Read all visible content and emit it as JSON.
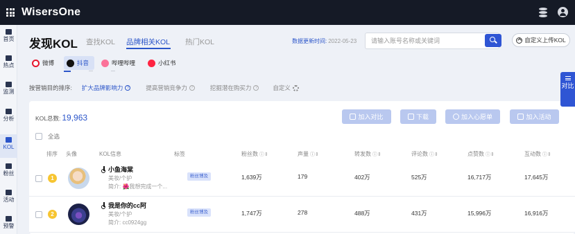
{
  "app": {
    "brand": "WisersOne"
  },
  "sidebar": {
    "items": [
      {
        "label": "首页",
        "icon": "home-icon"
      },
      {
        "label": "热点",
        "icon": "fire-icon"
      },
      {
        "label": "监测",
        "icon": "monitor-icon"
      },
      {
        "label": "分析",
        "icon": "analysis-icon"
      },
      {
        "label": "KOL",
        "icon": "kol-icon",
        "active": true
      },
      {
        "label": "粉丝",
        "icon": "fans-icon"
      },
      {
        "label": "活动",
        "icon": "activity-icon"
      },
      {
        "label": "预警",
        "icon": "alert-icon"
      }
    ]
  },
  "header": {
    "title": "发现KOL",
    "tabs": [
      {
        "label": "查找KOL",
        "active": false
      },
      {
        "label": "品牌相关KOL",
        "active": true
      },
      {
        "label": "热门KOL",
        "active": false
      }
    ],
    "update_label": "数据更新时间:",
    "update_value": "2022-05-23",
    "search_placeholder": "请输入账号名称或关键词",
    "upload_label": "自定义上传KOL"
  },
  "platforms": [
    {
      "label": "微博",
      "color": "#e6162d",
      "active": false
    },
    {
      "label": "抖音",
      "color": "#111111",
      "active": true
    },
    {
      "label": "哔哩哔哩",
      "color": "#fb7299",
      "active": false
    },
    {
      "label": "小红书",
      "color": "#ff2442",
      "active": false
    }
  ],
  "sort": {
    "label": "按营销目的排序:",
    "options": [
      {
        "label": "扩大品牌影响力",
        "active": true
      },
      {
        "label": "提高营销竞争力",
        "active": false
      },
      {
        "label": "挖掘潜在购买力",
        "active": false
      }
    ],
    "custom_label": "自定义"
  },
  "panel": {
    "total_label": "KOL总数:",
    "total_value": "19,963",
    "actions": [
      {
        "label": "加入对比",
        "icon": "compare-icon"
      },
      {
        "label": "下载",
        "icon": "download-icon"
      },
      {
        "label": "加入心愿单",
        "icon": "heart-icon"
      },
      {
        "label": "加入活动",
        "icon": "activity-icon"
      }
    ],
    "select_all": "全选"
  },
  "table": {
    "columns": {
      "rank": "排序",
      "avatar": "头像",
      "info": "KOL信息",
      "tags": "标签",
      "fans": "粉丝数",
      "voice": "声量",
      "reposts": "转发数",
      "comments": "评论数",
      "likes": "点赞数",
      "interactions": "互动数"
    },
    "rows": [
      {
        "rank": "1",
        "name": "小鱼海棠",
        "category": "美妆/个护",
        "bio": "简介: 🌺我想完成一个...",
        "tag": "粉丝博及",
        "fans": "1,639万",
        "voice": "179",
        "reposts": "402万",
        "comments": "525万",
        "likes": "16,717万",
        "interactions": "17,645万"
      },
      {
        "rank": "2",
        "name": "我是你的cc阿",
        "category": "美妆/个护",
        "bio": "简介: cc0924gg",
        "tag": "粉丝博及",
        "fans": "1,747万",
        "voice": "278",
        "reposts": "488万",
        "comments": "431万",
        "likes": "15,996万",
        "interactions": "16,916万"
      }
    ]
  },
  "float_button": {
    "label": "对比"
  },
  "colors": {
    "accent": "#2b55c9",
    "topbar": "#151a26",
    "rank_badge": "#f7c531",
    "action_button": "#b9c8ef"
  }
}
